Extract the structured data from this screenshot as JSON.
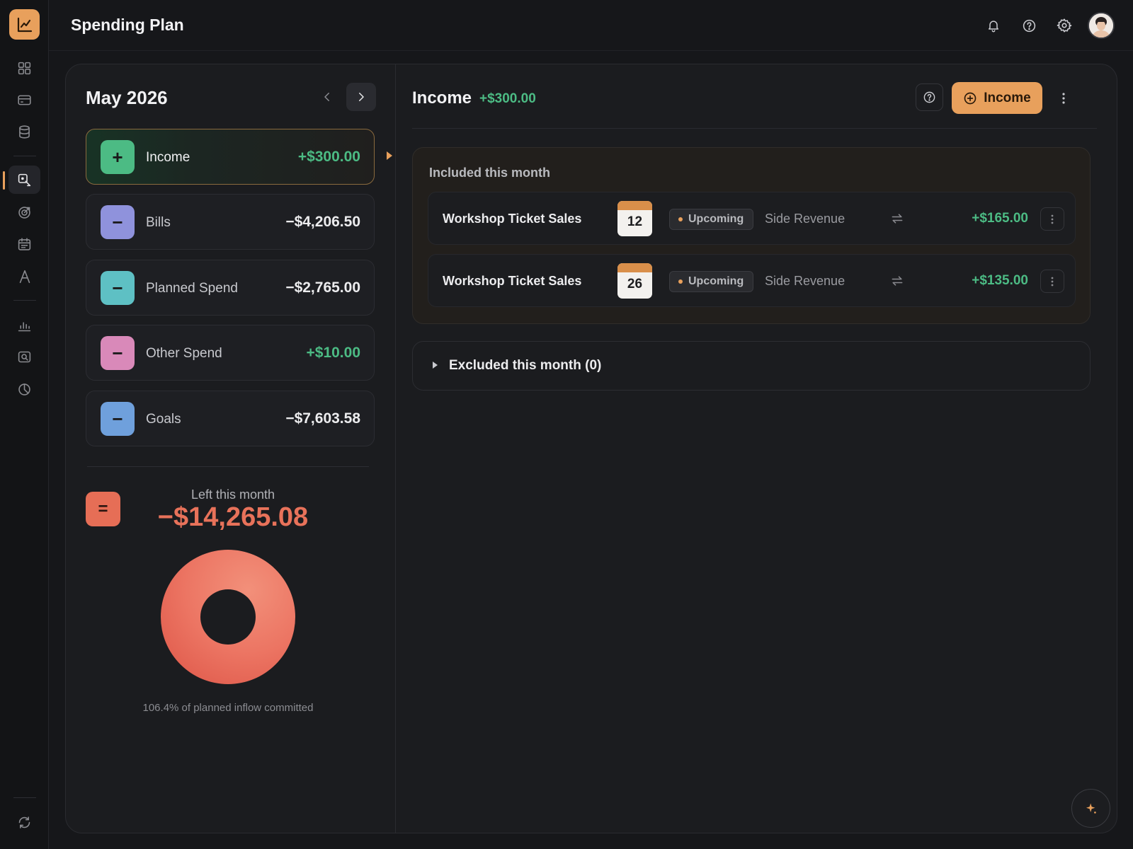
{
  "app": {
    "page_title": "Spending Plan",
    "accent_color": "#e8a05c"
  },
  "sidebar": {
    "logo_icon": "chart-line-icon",
    "items": [
      {
        "icon": "grid-icon",
        "active": false
      },
      {
        "icon": "credit-card-icon",
        "active": false
      },
      {
        "icon": "database-icon",
        "active": false
      },
      {
        "icon": "spending-plan-icon",
        "active": true
      },
      {
        "icon": "target-icon",
        "active": false
      },
      {
        "icon": "calendar-icon",
        "active": false
      },
      {
        "icon": "font-icon",
        "active": false
      },
      {
        "icon": "bar-chart-icon",
        "active": false
      },
      {
        "icon": "search-report-icon",
        "active": false
      },
      {
        "icon": "clock-pie-icon",
        "active": false
      }
    ],
    "footer_icon": "refresh-icon"
  },
  "topbar_icons": [
    "bell-icon",
    "help-icon",
    "gear-icon",
    "avatar"
  ],
  "plan": {
    "month_label": "May 2026",
    "categories": [
      {
        "label": "Income",
        "sign": "+",
        "amount": "+$300.00",
        "color": "#4cbb84",
        "selected": true
      },
      {
        "label": "Bills",
        "sign": "−",
        "amount": "−$4,206.50",
        "color": "#8f92dc",
        "selected": false
      },
      {
        "label": "Planned Spend",
        "sign": "−",
        "amount": "−$2,765.00",
        "color": "#5ec0c4",
        "selected": false
      },
      {
        "label": "Other Spend",
        "sign": "−",
        "amount": "+$10.00",
        "color": "#d989b9",
        "selected": false
      },
      {
        "label": "Goals",
        "sign": "−",
        "amount": "−$7,603.58",
        "color": "#6fa0dc",
        "selected": false
      }
    ],
    "left_symbol": "=",
    "left_label": "Left this month",
    "left_amount": "−$14,265.08",
    "committed_percent": 106.4,
    "committed_caption": "106.4% of planned inflow committed"
  },
  "detail": {
    "title": "Income",
    "total": "+$300.00",
    "add_button_label": "Income",
    "included_title": "Included this month",
    "rows": [
      {
        "name": "Workshop Ticket Sales",
        "day": "12",
        "status": "Upcoming",
        "category": "Side Revenue",
        "amount": "+$165.00"
      },
      {
        "name": "Workshop Ticket Sales",
        "day": "26",
        "status": "Upcoming",
        "category": "Side Revenue",
        "amount": "+$135.00"
      }
    ],
    "excluded_title": "Excluded this month (0)"
  }
}
